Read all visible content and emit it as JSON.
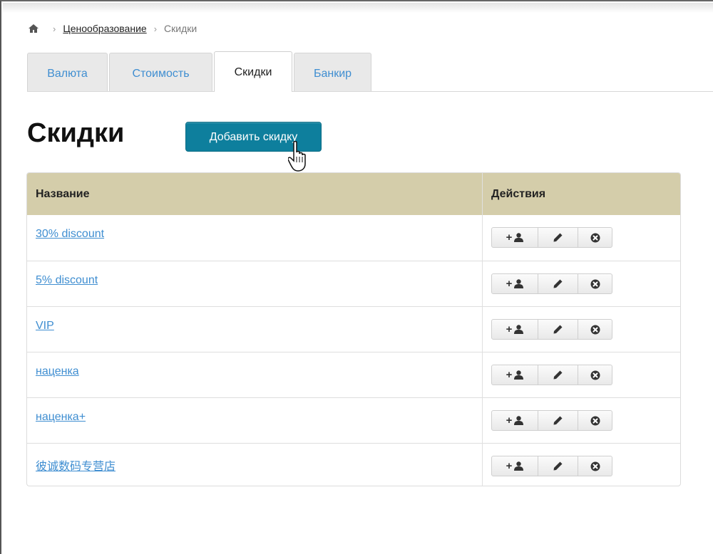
{
  "breadcrumb": {
    "home_icon": "home-icon",
    "separator": "›",
    "parent": "Ценообразование",
    "current": "Скидки"
  },
  "tabs": [
    {
      "label": "Валюта",
      "active": false
    },
    {
      "label": "Стоимость",
      "active": false
    },
    {
      "label": "Скидки",
      "active": true
    },
    {
      "label": "Банкир",
      "active": false
    }
  ],
  "page": {
    "title": "Скидки",
    "add_button_label": "Добавить скидку"
  },
  "table": {
    "columns": [
      "Название",
      "Действия"
    ],
    "rows": [
      {
        "name": "30% discount"
      },
      {
        "name": "5% discount"
      },
      {
        "name": "VIP"
      },
      {
        "name": "наценка"
      },
      {
        "name": "наценка+"
      },
      {
        "name": "彼诚数码专营店"
      }
    ],
    "row_actions": {
      "add_user_symbol": "+",
      "add_user_icon": "user-icon",
      "edit_icon": "pencil-icon",
      "delete_icon": "times-circle-icon"
    }
  },
  "colors": {
    "accent_button": "#0e7f9d",
    "table_header": "#d4cdaa",
    "link": "#3f8ed1"
  }
}
